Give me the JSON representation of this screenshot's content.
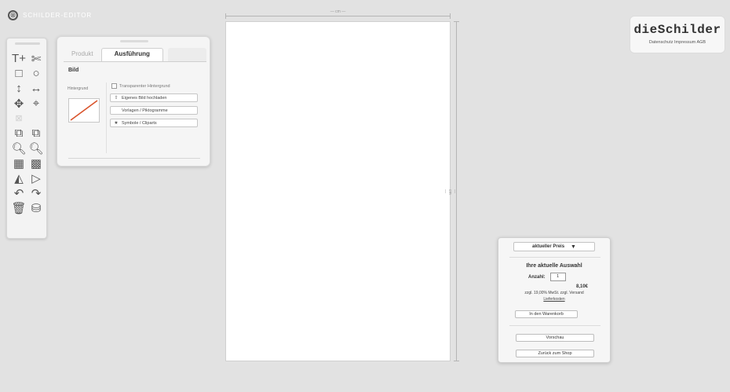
{
  "app": {
    "name": "SCHILDER-EDITOR"
  },
  "tools": [
    {
      "name": "text-tool-icon",
      "glyph": "T+"
    },
    {
      "name": "scissors-icon",
      "glyph": "✄"
    },
    {
      "name": "rectangle-tool-icon",
      "glyph": "□"
    },
    {
      "name": "ellipse-tool-icon",
      "glyph": "○"
    },
    {
      "name": "vertical-line-icon",
      "glyph": "↕"
    },
    {
      "name": "horizontal-line-icon",
      "glyph": "↔"
    },
    {
      "name": "move-icon",
      "glyph": "✥"
    },
    {
      "name": "center-icon",
      "glyph": "⌖"
    },
    {
      "name": "disabled-tool-icon",
      "glyph": "⊠"
    },
    {
      "name": "empty-slot",
      "glyph": ""
    },
    {
      "name": "bring-forward-icon",
      "glyph": "⧉"
    },
    {
      "name": "send-backward-icon",
      "glyph": "⧉"
    },
    {
      "name": "zoom-out-icon",
      "glyph": "🔍︎"
    },
    {
      "name": "zoom-in-icon",
      "glyph": "🔍︎"
    },
    {
      "name": "grid-icon",
      "glyph": "▦"
    },
    {
      "name": "qr-code-icon",
      "glyph": "▩"
    },
    {
      "name": "flip-horizontal-icon",
      "glyph": "◭"
    },
    {
      "name": "flip-vertical-icon",
      "glyph": "▷"
    },
    {
      "name": "undo-icon",
      "glyph": "↶"
    },
    {
      "name": "redo-icon",
      "glyph": "↷"
    },
    {
      "name": "delete-icon",
      "glyph": "🗑︎"
    },
    {
      "name": "save-icon",
      "glyph": "⛁"
    }
  ],
  "options_panel": {
    "tabs": [
      "Produkt",
      "Ausführung"
    ],
    "section_title": "Bild",
    "background_label": "Hintergrund",
    "transparent_label": "Transparenter Hintergrund",
    "buttons": [
      {
        "label": "Eigenes Bild hochladen",
        "icon": "upload-icon",
        "glyph": "⇧"
      },
      {
        "label": "Vorlagen / Piktogramme",
        "icon": "template-icon",
        "glyph": ""
      },
      {
        "label": "Symbole / Cliparts",
        "icon": "star-icon",
        "glyph": "★"
      }
    ]
  },
  "canvas": {
    "width_label": "— cm —",
    "height_label": "— cm —"
  },
  "brand": {
    "name": "dieSchilder",
    "tagline": "Datenschutz Impressum AGB"
  },
  "price_widget": {
    "select_label": "aktueller Preis",
    "title": "Ihre aktuelle Auswahl",
    "qty_label": "Anzahl:",
    "qty_value": "1",
    "price": "8,10€",
    "vat_text": "zzgl. 19,00% MwSt. zzgl. Versand",
    "vat_link": "Lieferkosten",
    "cart_button": "In den Warenkorb",
    "preview_button": "Vorschau",
    "back_button": "Zurück zum Shop"
  },
  "colors": {
    "swatch_diagonal": "#d9532b",
    "workspace_bg": "#e2e2e2"
  }
}
